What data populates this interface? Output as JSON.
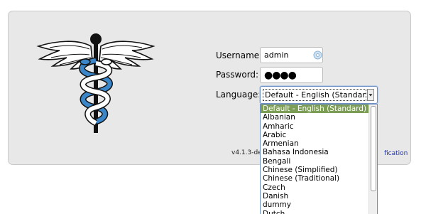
{
  "form": {
    "username_label": "Username:",
    "username_value": "admin",
    "password_label": "Password:",
    "password_value": "●●●●",
    "language_label": "Language:",
    "language_selected": "Default - English (Standard)"
  },
  "footer": {
    "version": "v4.1.3-de",
    "link_fragment": "fication"
  },
  "dropdown": {
    "options": [
      "Default - English (Standard)",
      "Albanian",
      "Amharic",
      "Arabic",
      "Armenian",
      "Bahasa Indonesia",
      "Bengali",
      "Chinese (Simplified)",
      "Chinese (Traditional)",
      "Czech",
      "Danish",
      "dummy",
      "Dutch"
    ]
  },
  "colors": {
    "panel_bg": "#e8e8e8",
    "caduceus_blue": "#3a86c8",
    "selected_option": "#7c9d55",
    "link": "#2233aa"
  },
  "icons": {
    "logo": "caduceus-logo",
    "password_manager": "password-manager-icon",
    "select_arrow": "chevron-down-icon"
  }
}
